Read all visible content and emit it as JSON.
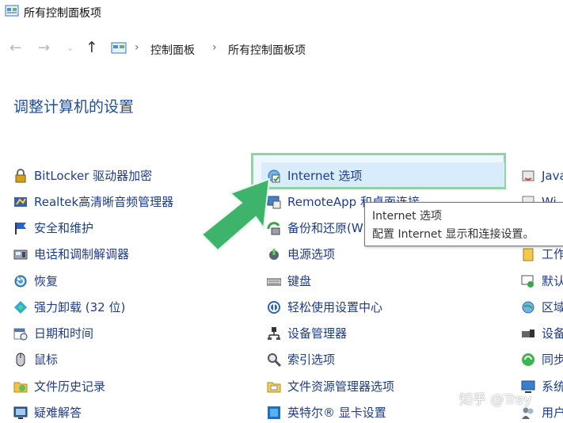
{
  "window": {
    "title": "所有控制面板项"
  },
  "nav": {
    "breadcrumb": [
      "控制面板",
      "所有控制面板项"
    ],
    "separator": "›"
  },
  "heading": "调整计算机的设置",
  "columns": {
    "left": [
      {
        "label": "BitLocker 驱动器加密",
        "icon": "bitlocker-icon"
      },
      {
        "label": "Realtek高清晰音频管理器",
        "icon": "realtek-audio-icon"
      },
      {
        "label": "安全和维护",
        "icon": "flag-icon"
      },
      {
        "label": "电话和调制解调器",
        "icon": "phone-modem-icon"
      },
      {
        "label": "恢复",
        "icon": "recovery-icon"
      },
      {
        "label": "强力卸载 (32 位)",
        "icon": "uninstall-icon"
      },
      {
        "label": "日期和时间",
        "icon": "date-time-icon"
      },
      {
        "label": "鼠标",
        "icon": "mouse-icon"
      },
      {
        "label": "文件历史记录",
        "icon": "file-history-icon"
      },
      {
        "label": "疑难解答",
        "icon": "troubleshoot-icon"
      }
    ],
    "middle": [
      {
        "label": "Internet 选项",
        "icon": "internet-options-icon"
      },
      {
        "label": "RemoteApp 和桌面连接",
        "icon": "remoteapp-icon"
      },
      {
        "label": "备份和还原(W",
        "icon": "backup-icon"
      },
      {
        "label": "电源选项",
        "icon": "power-icon"
      },
      {
        "label": "键盘",
        "icon": "keyboard-icon"
      },
      {
        "label": "轻松使用设置中心",
        "icon": "ease-of-access-icon"
      },
      {
        "label": "设备管理器",
        "icon": "device-manager-icon"
      },
      {
        "label": "索引选项",
        "icon": "indexing-icon"
      },
      {
        "label": "文件资源管理器选项",
        "icon": "folder-options-icon"
      },
      {
        "label": "英特尔® 显卡设置",
        "icon": "intel-graphics-icon"
      }
    ],
    "right": [
      {
        "label": "Java",
        "icon": "java-icon"
      },
      {
        "label": "Wi",
        "icon": "windows-icon"
      },
      {
        "label": "",
        "icon": "blank-icon"
      },
      {
        "label": "工作",
        "icon": "work-folders-icon"
      },
      {
        "label": "默认",
        "icon": "default-programs-icon"
      },
      {
        "label": "区域",
        "icon": "region-icon"
      },
      {
        "label": "设备",
        "icon": "devices-icon"
      },
      {
        "label": "同步",
        "icon": "sync-icon"
      },
      {
        "label": "系统",
        "icon": "system-icon"
      },
      {
        "label": "用户",
        "icon": "users-icon"
      }
    ]
  },
  "tooltip": {
    "title": "Internet 选项",
    "description": "配置 Internet 显示和连接设置。"
  },
  "watermark": "知乎 @Trey",
  "colors": {
    "link": "#1e3c8c",
    "heading": "#1f4e99",
    "highlight_border": "#92d3a6",
    "arrow": "#3db36b"
  }
}
